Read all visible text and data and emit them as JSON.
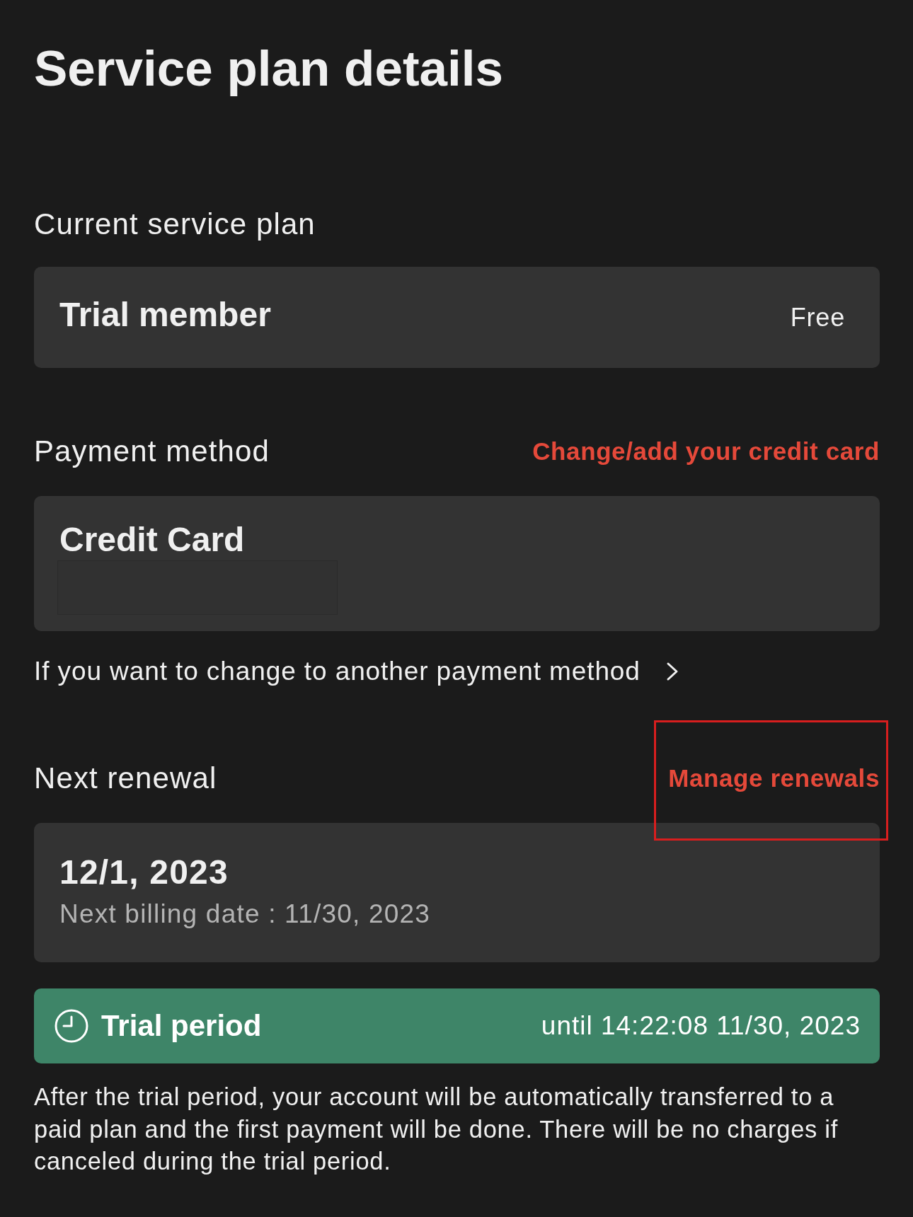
{
  "title": "Service plan details",
  "current_plan": {
    "label": "Current service plan",
    "name": "Trial member",
    "price": "Free"
  },
  "payment": {
    "label": "Payment method",
    "action": {
      "text": "Change/add your credit card"
    },
    "method": "Credit Card",
    "details_hidden": true,
    "other_method_link": "If you want to change to another payment method"
  },
  "next_renewal": {
    "label": "Next renewal",
    "action": {
      "text": "Manage renewals",
      "highlighted": true
    },
    "date": "12/1, 2023",
    "billing_date": "Next billing date : 11/30, 2023"
  },
  "trial": {
    "label": "Trial period",
    "until": "until 14:22:08 11/30, 2023"
  },
  "note": "After the trial period, your account will be automatically transferred to a paid plan and the first payment will be done. There will be no charges if canceled during the trial period."
}
